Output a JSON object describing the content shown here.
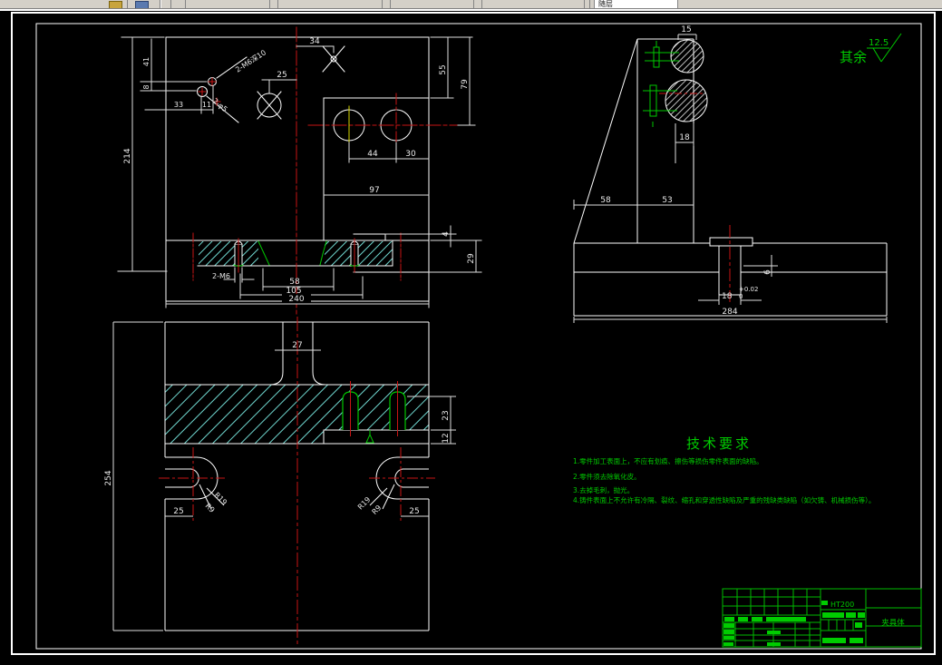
{
  "toolbar": {
    "layer_combo_value": "随层"
  },
  "surface_note": {
    "prefix": "其余",
    "roughness": "12.5"
  },
  "front_view": {
    "dim_214": "214",
    "dim_41": "41",
    "dim_8": "8",
    "dim_33": "33",
    "dim_11": "11",
    "leader_tap": "2-M6深10",
    "leader_hole": "2-φ5",
    "dim_34": "34",
    "dim_25": "25",
    "dim_55": "55",
    "dim_79": "79",
    "dim_44": "44",
    "dim_30": "30",
    "dim_97": "97",
    "dim_4": "4",
    "dim_29": "29",
    "label_2m6": "2-M6",
    "dim_58": "58",
    "dim_105": "105",
    "dim_240": "240"
  },
  "side_view": {
    "dim_15": "15",
    "dim_18_top": "18",
    "dim_58": "58",
    "dim_53": "53",
    "dim_6": "6",
    "dim_18_main": "18",
    "tol_upper": "+0.02",
    "tol_lower": "0",
    "dim_284": "284"
  },
  "top_view": {
    "dim_27": "27",
    "dim_254": "254",
    "dim_23": "23",
    "dim_12": "12",
    "dim_25_left": "25",
    "dim_25_right": "25",
    "r_outer_left": "R19",
    "r_inner_left": "R9",
    "r_outer_right": "R19",
    "r_inner_right": "R9"
  },
  "tech_req": {
    "title": "技术要求",
    "items": [
      "1.零件加工表面上，不应有划痕、擦伤等损伤零件表面的缺陷。",
      "2.零件须去除氧化皮。",
      "3.去掉毛刺，抛光。",
      "4.铸件表面上不允许有冷隔、裂纹、缩孔和穿透性缺陷及严重的残缺类缺陷（如欠铸、机械损伤等）。"
    ]
  },
  "title_block": {
    "material": "HT200",
    "part_name": "夹具体"
  }
}
